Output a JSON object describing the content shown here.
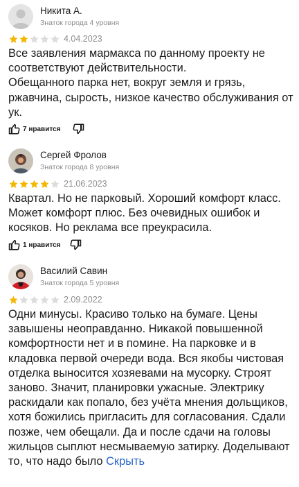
{
  "colors": {
    "star_filled": "#f2b700",
    "star_empty": "#dcdcdc",
    "link": "#2b64c9",
    "meta": "#8c8c8c"
  },
  "reviews": [
    {
      "author": "Никита А.",
      "level": "Знаток города 4 уровня",
      "rating": 2,
      "date": "4.04.2023",
      "text": "Все заявления мармакса по данному проекту не соответствуют действительности.\nОбещанного парка нет, вокруг земля и грязь, ржавчина, сырость, низкое качество обслуживания от ук.",
      "likes_label": "7 нравится",
      "icons": {
        "like": "thumbs-up-icon",
        "dislike": "thumbs-down-icon"
      }
    },
    {
      "author": "Сергей Фролов",
      "level": "Знаток города 8 уровня",
      "rating": 4,
      "date": "21.06.2023",
      "text": "Квартал. Но не парковый. Хороший комфорт класс. Может комфорт плюс. Без очевидных ошибок и косяков. Но реклама все преукрасила.",
      "likes_label": "1 нравится",
      "icons": {
        "like": "thumbs-up-icon",
        "dislike": "thumbs-down-icon"
      }
    },
    {
      "author": "Василий Савин",
      "level": "Знаток города 5 уровня",
      "rating": 1,
      "date": "2.09.2022",
      "text": "Одни минусы. Красиво только на бумаге. Цены завышены неоправданно. Никакой повышенной комфортности нет и в помине. На парковке и в кладовка первой очереди вода. Вся якобы чистовая отделка выносится хозяевами на мусорку. Строят заново. Значит, планировки ужасные. Электрику раскидали как попало, без учёта мнения дольщиков, хотя божились пригласить для согласования. Сдали позже, чем обещали. Да и после сдачи на головы жильцов сыплют несмываемую затирку. Доделывают то, что надо было",
      "collapse_label": "Скрыть"
    }
  ]
}
